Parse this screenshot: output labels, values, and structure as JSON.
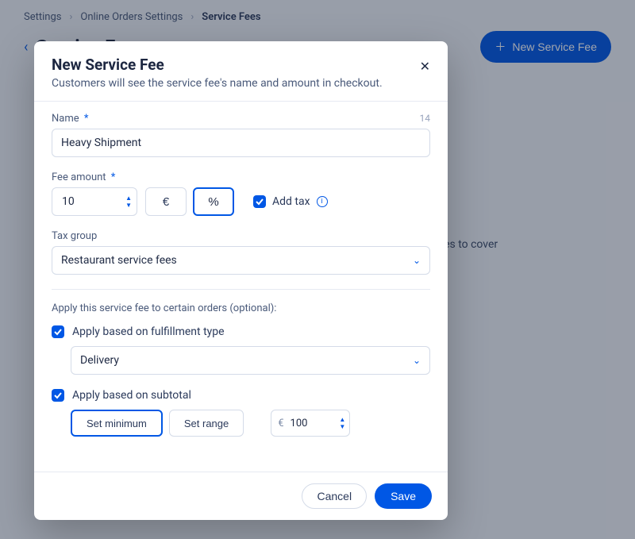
{
  "breadcrumbs": {
    "item1": "Settings",
    "item2": "Online Orders Settings",
    "item3": "Service Fees"
  },
  "page_header": {
    "title": "Service Fees",
    "new_button": "New Service Fee",
    "background_text": "types to cover"
  },
  "modal": {
    "title": "New Service Fee",
    "subtitle": "Customers will see the service fee's name and amount in checkout.",
    "name": {
      "label": "Name",
      "value": "Heavy Shipment",
      "counter": "14"
    },
    "fee_amount": {
      "label": "Fee amount",
      "value": "10",
      "currency_symbol": "€",
      "percent_symbol": "%",
      "selected_unit": "percent",
      "add_tax_label": "Add tax",
      "add_tax_checked": true
    },
    "tax_group": {
      "label": "Tax group",
      "value": "Restaurant service fees"
    },
    "apply_section_label": "Apply this service fee to certain orders (optional):",
    "fulfillment": {
      "checkbox_label": "Apply based on fulfillment type",
      "checked": true,
      "value": "Delivery"
    },
    "subtotal": {
      "checkbox_label": "Apply based on subtotal",
      "checked": true,
      "set_minimum_label": "Set minimum",
      "set_range_label": "Set range",
      "selected_mode": "minimum",
      "currency_symbol": "€",
      "min_value": "100"
    },
    "footer": {
      "cancel": "Cancel",
      "save": "Save"
    }
  }
}
